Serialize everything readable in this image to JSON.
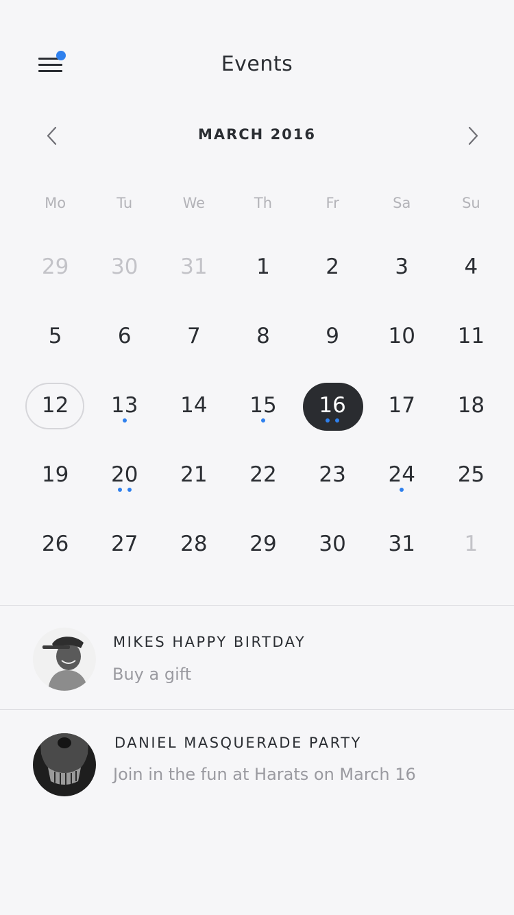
{
  "header": {
    "title": "Events",
    "menu_icon": "hamburger-menu-icon",
    "notification_color": "#2f80ed"
  },
  "calendar": {
    "month_label": "MARCH 2016",
    "prev_icon": "chevron-left-icon",
    "next_icon": "chevron-right-icon",
    "weekdays": [
      "Mo",
      "Tu",
      "We",
      "Th",
      "Fr",
      "Sa",
      "Su"
    ],
    "weeks": [
      [
        {
          "d": "29",
          "muted": true,
          "dots": 0
        },
        {
          "d": "30",
          "muted": true,
          "dots": 0
        },
        {
          "d": "31",
          "muted": true,
          "dots": 0
        },
        {
          "d": "1",
          "dots": 0
        },
        {
          "d": "2",
          "dots": 0
        },
        {
          "d": "3",
          "dots": 0
        },
        {
          "d": "4",
          "dots": 0
        }
      ],
      [
        {
          "d": "5",
          "dots": 0
        },
        {
          "d": "6",
          "dots": 0
        },
        {
          "d": "7",
          "dots": 0
        },
        {
          "d": "8",
          "dots": 0
        },
        {
          "d": "9",
          "dots": 0
        },
        {
          "d": "10",
          "dots": 0
        },
        {
          "d": "11",
          "dots": 0
        }
      ],
      [
        {
          "d": "12",
          "today": true,
          "dots": 0
        },
        {
          "d": "13",
          "dots": 1
        },
        {
          "d": "14",
          "dots": 0
        },
        {
          "d": "15",
          "dots": 1
        },
        {
          "d": "16",
          "selected": true,
          "dots": 2
        },
        {
          "d": "17",
          "dots": 0
        },
        {
          "d": "18",
          "dots": 0
        }
      ],
      [
        {
          "d": "19",
          "dots": 0
        },
        {
          "d": "20",
          "dots": 2
        },
        {
          "d": "21",
          "dots": 0
        },
        {
          "d": "22",
          "dots": 0
        },
        {
          "d": "23",
          "dots": 0
        },
        {
          "d": "24",
          "dots": 1
        },
        {
          "d": "25",
          "dots": 0
        }
      ],
      [
        {
          "d": "26",
          "dots": 0
        },
        {
          "d": "27",
          "dots": 0
        },
        {
          "d": "28",
          "dots": 0
        },
        {
          "d": "29",
          "dots": 0
        },
        {
          "d": "30",
          "dots": 0
        },
        {
          "d": "31",
          "dots": 0
        },
        {
          "d": "1",
          "muted": true,
          "dots": 0
        }
      ]
    ],
    "event_dot_color": "#2f80ed",
    "selected_color": "#2a2c30"
  },
  "events": [
    {
      "title": "MIKES HAPPY BIRTDAY",
      "subtitle": "Buy a gift",
      "avatar_icon": "avatar-mike"
    },
    {
      "title": "DANIEL MASQUERADE PARTY",
      "subtitle": "Join in the fun at Harats on March 16",
      "avatar_icon": "avatar-daniel"
    }
  ]
}
